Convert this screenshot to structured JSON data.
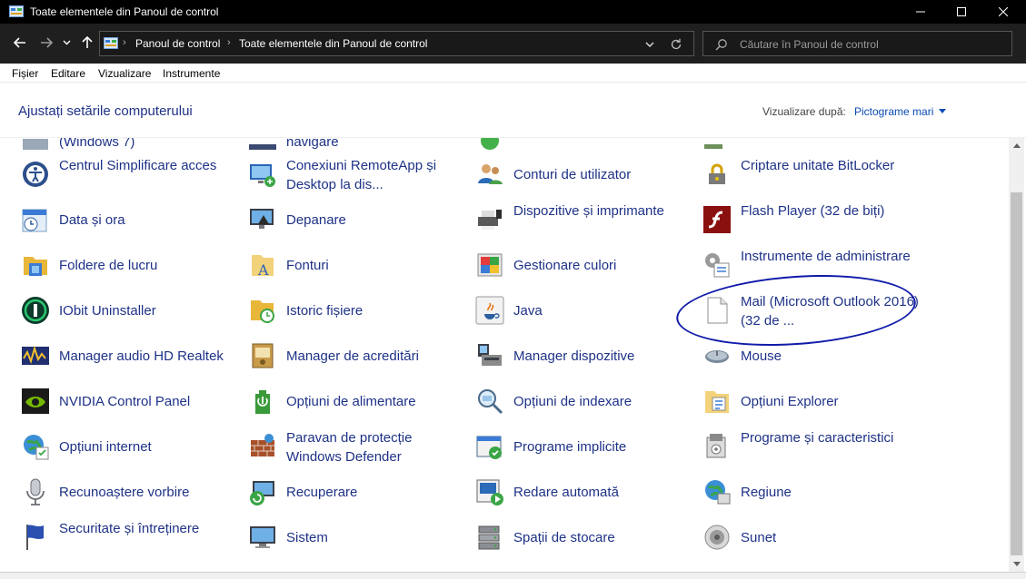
{
  "window": {
    "title": "Toate elementele din Panoul de control"
  },
  "address": {
    "crumbs": [
      "Panoul de control",
      "Toate elementele din Panoul de control"
    ]
  },
  "search": {
    "placeholder": "Căutare în Panoul de control"
  },
  "menu": [
    "Fișier",
    "Editare",
    "Vizualizare",
    "Instrumente"
  ],
  "header": {
    "title": "Ajustați setările computerului",
    "view_label": "Vizualizare după:",
    "view_value": "Pictograme mari"
  },
  "partial_row": [
    "(Windows 7)",
    "navigare"
  ],
  "items": [
    [
      "Centrul Simplificare acces",
      "Conexiuni RemoteApp și Desktop la dis...",
      "Conturi de utilizator",
      "Criptare unitate BitLocker"
    ],
    [
      "Data și ora",
      "Depanare",
      "Dispozitive și imprimante",
      "Flash Player (32 de biți)"
    ],
    [
      "Foldere de lucru",
      "Fonturi",
      "Gestionare culori",
      "Instrumente de administrare"
    ],
    [
      "IObit Uninstaller",
      "Istoric fișiere",
      "Java",
      "Mail (Microsoft Outlook 2016) (32 de ..."
    ],
    [
      "Manager audio HD Realtek",
      "Manager de acreditări",
      "Manager dispozitive",
      "Mouse"
    ],
    [
      "NVIDIA Control Panel",
      "Opțiuni de alimentare",
      "Opțiuni de indexare",
      "Opțiuni Explorer"
    ],
    [
      "Opțiuni internet",
      "Paravan de protecție Windows Defender",
      "Programe implicite",
      "Programe și caracteristici"
    ],
    [
      "Recunoaștere vorbire",
      "Recuperare",
      "Redare automată",
      "Regiune"
    ],
    [
      "Securitate și întreținere",
      "Sistem",
      "Spații de stocare",
      "Sunet"
    ]
  ],
  "icons": [
    [
      "accessibility-icon",
      "remote-desktop-icon",
      "user-accounts-icon",
      "bitlocker-icon"
    ],
    [
      "date-time-icon",
      "troubleshooting-icon",
      "devices-printers-icon",
      "flash-player-icon"
    ],
    [
      "work-folders-icon",
      "fonts-icon",
      "color-management-icon",
      "admin-tools-icon"
    ],
    [
      "iobit-uninstaller-icon",
      "file-history-icon",
      "java-icon",
      "mail-icon"
    ],
    [
      "realtek-audio-icon",
      "credential-manager-icon",
      "device-manager-icon",
      "mouse-icon"
    ],
    [
      "nvidia-icon",
      "power-options-icon",
      "indexing-options-icon",
      "explorer-options-icon"
    ],
    [
      "internet-options-icon",
      "firewall-icon",
      "default-programs-icon",
      "programs-features-icon"
    ],
    [
      "speech-recognition-icon",
      "recovery-icon",
      "autoplay-icon",
      "region-icon"
    ],
    [
      "security-maintenance-icon",
      "system-icon",
      "storage-spaces-icon",
      "sound-icon"
    ]
  ],
  "colors": {
    "link": "#1e3287",
    "annotation": "#0f1aa8",
    "titlebar": "#000000",
    "navbar": "#1f1f1f"
  }
}
